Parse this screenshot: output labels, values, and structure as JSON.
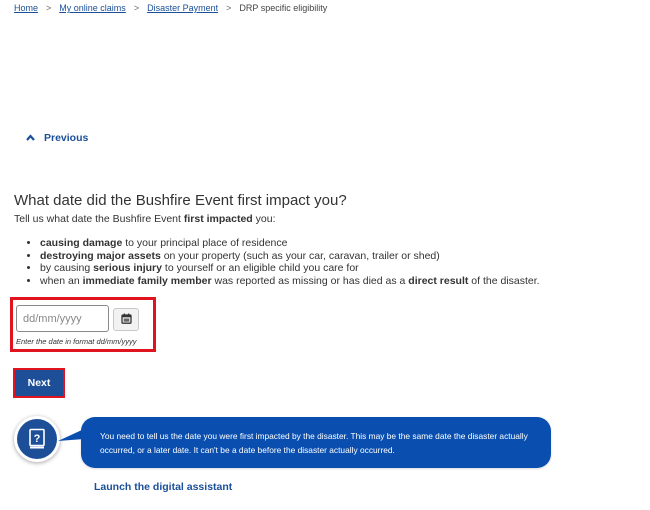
{
  "breadcrumb": {
    "items": [
      {
        "label": "Home",
        "link": true
      },
      {
        "label": "My online claims",
        "link": true
      },
      {
        "label": "Disaster Payment",
        "link": true
      },
      {
        "label": "DRP specific eligibility",
        "link": false
      }
    ],
    "separator": ">"
  },
  "nav": {
    "previous_label": "Previous",
    "previous_icon": "chevron-up-icon"
  },
  "question": {
    "title": "What date did the Bushfire Event first impact you?",
    "intro_prefix": "Tell us what date the Bushfire Event ",
    "intro_bold": "first impacted",
    "intro_suffix": " you:",
    "bullets": [
      {
        "pre": "",
        "bold": "causing damage",
        "post": " to your principal place of residence"
      },
      {
        "pre": "",
        "bold": "destroying major assets",
        "post": " on your property (such as your car, caravan, trailer or shed)"
      },
      {
        "pre": "by causing ",
        "bold": "serious injury",
        "post": " to yourself or an eligible child you care for"
      },
      {
        "pre": "when an ",
        "bold": "immediate family member",
        "post": " was reported as missing or has died as a ",
        "bold2": "direct result",
        "post2": " of the disaster."
      }
    ]
  },
  "date_field": {
    "value": "",
    "placeholder": "dd/mm/yyyy",
    "hint": "Enter the date in format dd/mm/yyyy",
    "calendar_icon": "calendar-icon"
  },
  "actions": {
    "next_label": "Next"
  },
  "assistant": {
    "icon": "help-book-icon",
    "message": "You need to tell us the date you were first impacted by the disaster. This may be the same date the disaster actually occurred, or a later date. It can't be a date before the disaster actually occurred.",
    "launch_label": "Launch the digital assistant"
  },
  "colors": {
    "link": "#1a4f99",
    "primary_button": "#1d4f99",
    "highlight_border": "#e0141e",
    "bubble": "#0a4fb0"
  }
}
